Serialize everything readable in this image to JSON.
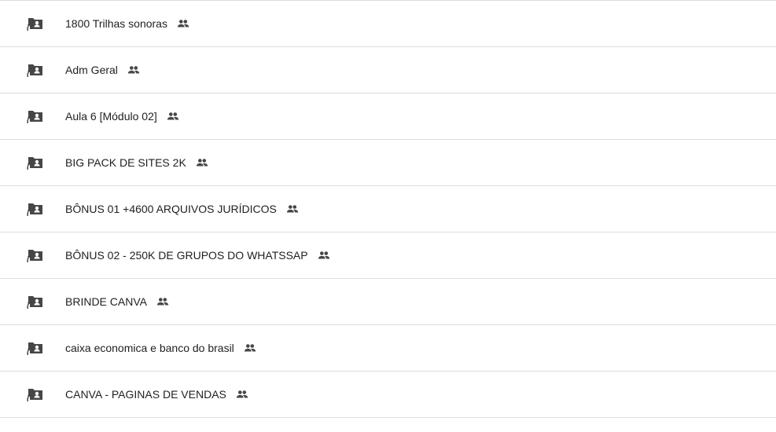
{
  "rows": [
    {
      "name": "1800 Trilhas sonoras"
    },
    {
      "name": "Adm Geral"
    },
    {
      "name": "Aula 6 [Módulo 02]"
    },
    {
      "name": "BIG PACK DE SITES 2K"
    },
    {
      "name": "BÔNUS 01 +4600 ARQUIVOS JURÍDICOS"
    },
    {
      "name": "BÔNUS 02 - 250K DE GRUPOS DO WHATSSAP"
    },
    {
      "name": "BRINDE CANVA"
    },
    {
      "name": "caixa economica e banco do brasil"
    },
    {
      "name": "CANVA - PAGINAS DE VENDAS"
    }
  ],
  "icons": {
    "folder": "shared-folder-icon",
    "shared": "people-icon"
  },
  "colors": {
    "icon": "#444746",
    "divider": "#dadce0",
    "text": "#1f1f1f"
  }
}
